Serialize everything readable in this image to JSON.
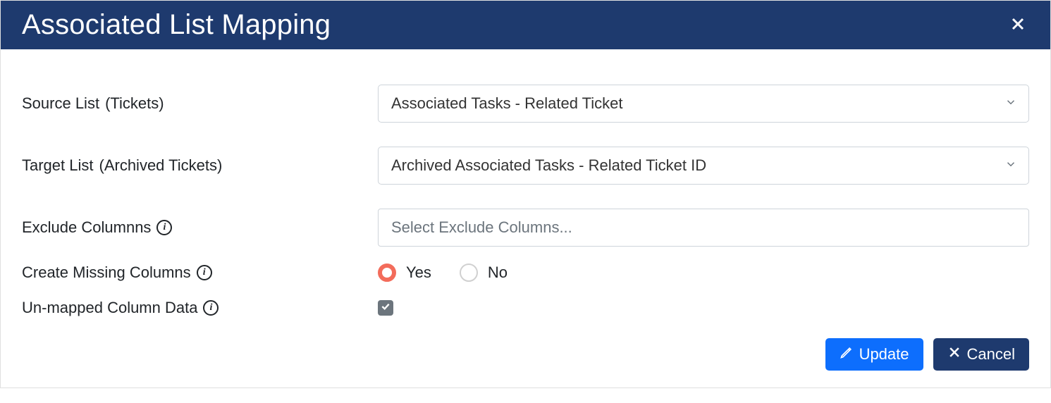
{
  "header": {
    "title": "Associated List Mapping"
  },
  "form": {
    "source_list": {
      "label": "Source List",
      "context": "(Tickets)",
      "value": "Associated Tasks - Related Ticket"
    },
    "target_list": {
      "label": "Target List",
      "context": "(Archived Tickets)",
      "value": "Archived Associated Tasks - Related Ticket ID"
    },
    "exclude_columns": {
      "label": "Exclude Columnns",
      "placeholder": "Select Exclude Columns..."
    },
    "create_missing": {
      "label": "Create Missing Columns",
      "yes": "Yes",
      "no": "No"
    },
    "unmapped": {
      "label": "Un-mapped Column Data"
    }
  },
  "footer": {
    "update": "Update",
    "cancel": "Cancel"
  }
}
